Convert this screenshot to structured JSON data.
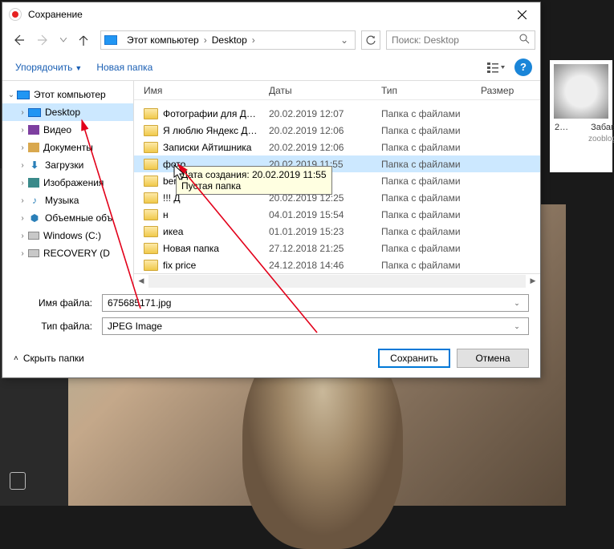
{
  "dialog": {
    "title": "Сохранение"
  },
  "breadcrumb": {
    "seg1": "Этот компьютер",
    "seg2": "Desktop"
  },
  "search": {
    "placeholder": "Поиск: Desktop"
  },
  "toolbar": {
    "organize": "Упорядочить",
    "new_folder": "Новая папка"
  },
  "tree": {
    "this_pc": "Этот компьютер",
    "desktop": "Desktop",
    "videos": "Видео",
    "documents": "Документы",
    "downloads": "Загрузки",
    "pictures": "Изображения",
    "music": "Музыка",
    "objects3d": "Объемные объ",
    "win_c": "Windows (C:)",
    "recovery_d": "RECOVERY (D"
  },
  "columns": {
    "name": "Имя",
    "date": "Даты",
    "type": "Тип",
    "size": "Размер"
  },
  "file_type_folder": "Папка с файлами",
  "rows": [
    {
      "name": "Фотографии для Д…",
      "date": "20.02.2019 12:07"
    },
    {
      "name": "Я люблю Яндекс Д…",
      "date": "20.02.2019 12:06"
    },
    {
      "name": "Записки Айтишника",
      "date": "20.02.2019 12:06"
    },
    {
      "name": "фото",
      "date": "20.02.2019 11:55"
    },
    {
      "name": "ber",
      "date": ""
    },
    {
      "name": "!!! Д",
      "date": ""
    },
    {
      "name": "н",
      "date": "04.01.2019 15:54"
    },
    {
      "name": "икеа",
      "date": "01.01.2019 15:23"
    },
    {
      "name": "Новая папка",
      "date": "27.12.2018 21:25"
    },
    {
      "name": "fix price",
      "date": "24.12.2018 14:46"
    }
  ],
  "tooltip": {
    "line1": "Дата создания: 20.02.2019 11:55",
    "line2": "Пустая папка"
  },
  "fields": {
    "filename_label": "Имя файла:",
    "filename_value": "675685171.jpg",
    "filetype_label": "Тип файла:",
    "filetype_value": "JPEG Image"
  },
  "footer": {
    "hide_folders": "Скрыть папки",
    "save": "Сохранить",
    "cancel": "Отмена"
  },
  "thumbs": {
    "caption1": "2…",
    "caption2": "Забавн",
    "sub2": "zooblog"
  }
}
